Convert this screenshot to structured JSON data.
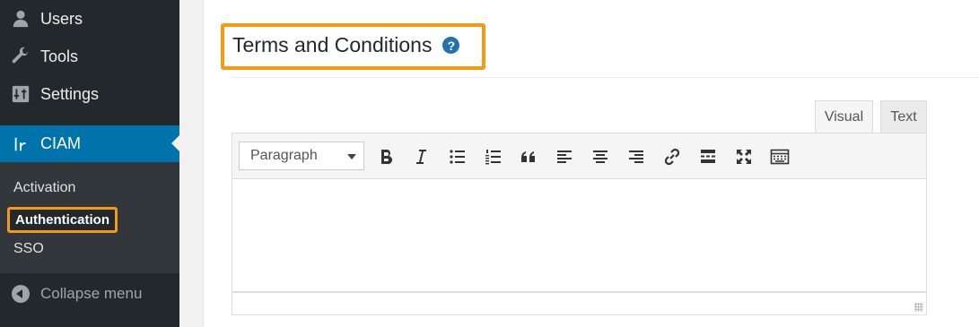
{
  "sidebar": {
    "users": "Users",
    "tools": "Tools",
    "settings": "Settings",
    "ciam": "CIAM",
    "submenu": {
      "activation": "Activation",
      "authentication": "Authentication",
      "sso": "SSO"
    },
    "collapse": "Collapse menu"
  },
  "main": {
    "title": "Terms and Conditions",
    "help": "?",
    "tabs": {
      "visual": "Visual",
      "text": "Text"
    },
    "format_select": "Paragraph"
  },
  "colors": {
    "highlight": "#f39c12",
    "accent": "#0073aa",
    "sidebar": "#23282d"
  }
}
